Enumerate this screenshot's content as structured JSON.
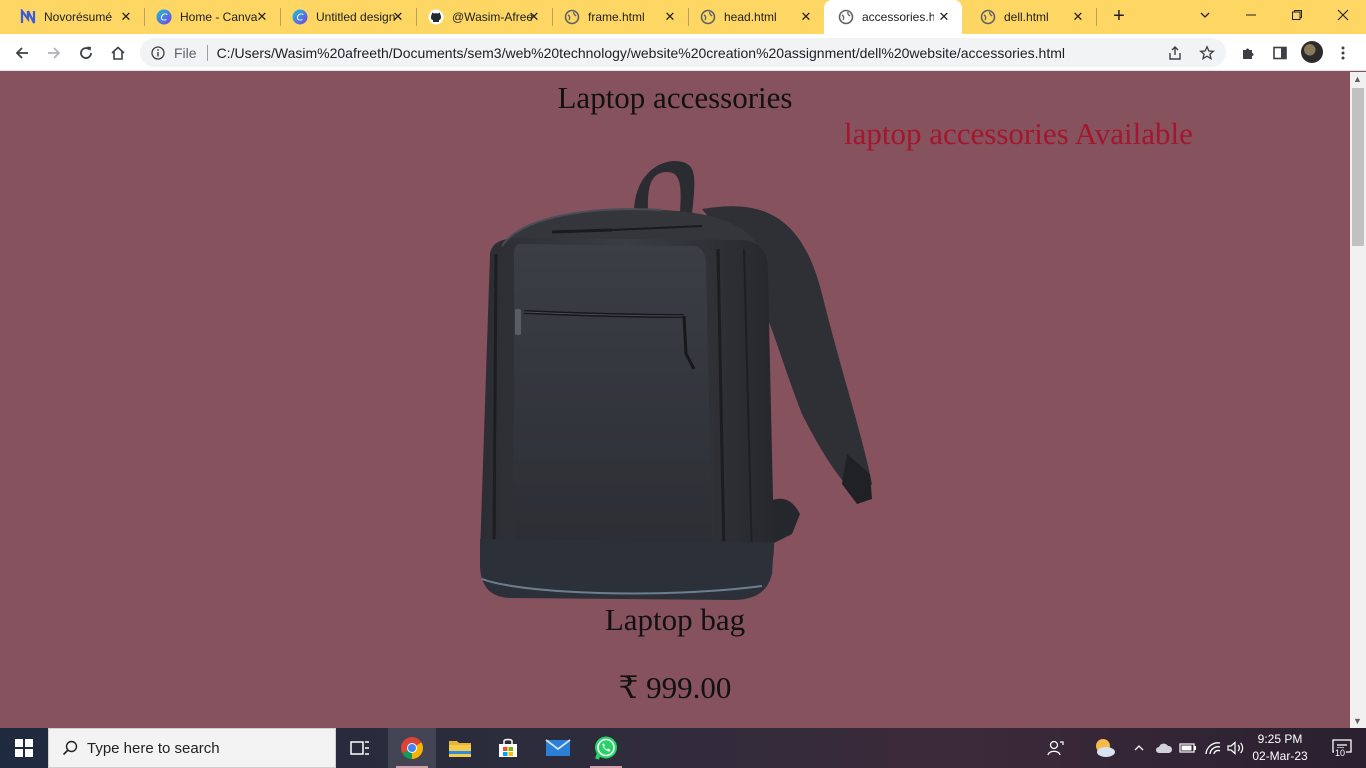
{
  "browser": {
    "tabs": [
      {
        "title": "Novorésumé",
        "icon": "novoresume-icon",
        "active": false
      },
      {
        "title": "Home - Canva",
        "icon": "canva-icon",
        "active": false
      },
      {
        "title": "Untitled design",
        "icon": "canva-icon",
        "active": false
      },
      {
        "title": "@Wasim-Afreeth",
        "icon": "github-icon",
        "active": false
      },
      {
        "title": "frame.html",
        "icon": "globe-icon",
        "active": false
      },
      {
        "title": "head.html",
        "icon": "globe-icon",
        "active": false
      },
      {
        "title": "accessories.html",
        "icon": "globe-icon",
        "active": true
      },
      {
        "title": "dell.html",
        "icon": "globe-icon",
        "active": false
      }
    ],
    "new_tab_label": "+",
    "omnibox": {
      "scheme_label": "File",
      "url": "C:/Users/Wasim%20afreeth/Documents/sem3/web%20technology/website%20creation%20assignment/dell%20website/accessories.html"
    },
    "colors": {
      "tabstrip": "#fdd663",
      "active_tab": "#ffffff"
    }
  },
  "page": {
    "heading": "Laptop accessories",
    "availability_text": "laptop accessories Available",
    "product": {
      "image": "laptop-backpack-image",
      "name": "Laptop bag",
      "price": "₹ 999.00"
    },
    "colors": {
      "background": "#85525d",
      "availability": "#a4162f",
      "text": "#111111"
    }
  },
  "taskbar": {
    "search_placeholder": "Type here to search",
    "apps": [
      "task-view-icon",
      "chrome-icon",
      "file-explorer-icon",
      "microsoft-store-icon",
      "mail-icon",
      "whatsapp-icon"
    ],
    "clock": {
      "time": "9:25 PM",
      "date": "02-Mar-23"
    },
    "notification_count": "10"
  }
}
